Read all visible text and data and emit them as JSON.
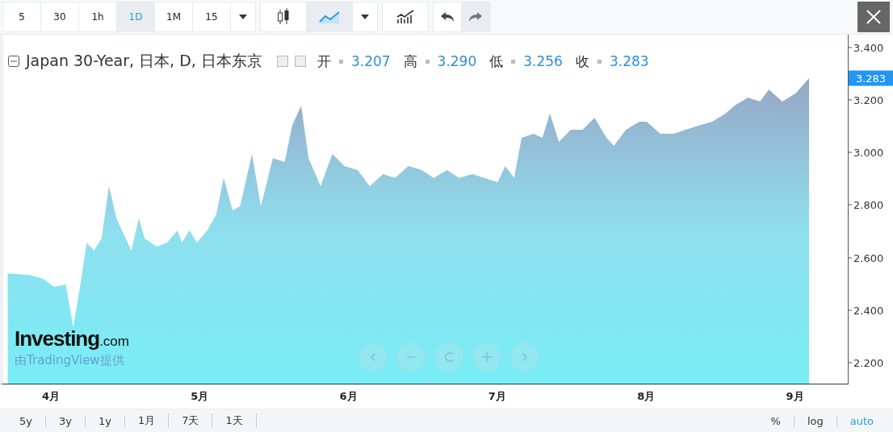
{
  "toolbar": {
    "intervals": [
      {
        "label": "5",
        "selected": false
      },
      {
        "label": "30",
        "selected": false
      },
      {
        "label": "1h",
        "selected": false
      },
      {
        "label": "1D",
        "selected": true
      },
      {
        "label": "1M",
        "selected": false
      },
      {
        "label": "15",
        "selected": false
      }
    ],
    "chart_types": [
      {
        "kind": "candles",
        "selected": false
      },
      {
        "kind": "area",
        "selected": true
      }
    ]
  },
  "legend": {
    "title": "Japan 30-Year, 日本, D, 日本东京",
    "ohlc": [
      {
        "label": "开",
        "value": "3.207"
      },
      {
        "label": "高",
        "value": "3.290"
      },
      {
        "label": "低",
        "value": "3.256"
      },
      {
        "label": "收",
        "value": "3.283"
      }
    ]
  },
  "last_price": "3.283",
  "logo": {
    "name": "Investing",
    "suffix": ".com",
    "credit": "由TradingView提供"
  },
  "chart": {
    "chart_data": {
      "type": "area",
      "x": [
        3.71,
        3.85,
        3.95,
        4.02,
        4.1,
        4.15,
        4.2,
        4.24,
        4.29,
        4.34,
        4.39,
        4.44,
        4.49,
        4.54,
        4.59,
        4.63,
        4.71,
        4.78,
        4.85,
        4.88,
        4.93,
        4.98,
        5.05,
        5.11,
        5.16,
        5.22,
        5.27,
        5.35,
        5.41,
        5.49,
        5.57,
        5.62,
        5.68,
        5.73,
        5.81,
        5.89,
        5.97,
        6.06,
        6.14,
        6.23,
        6.31,
        6.4,
        6.49,
        6.57,
        6.66,
        6.74,
        6.83,
        6.91,
        7.0,
        7.05,
        7.11,
        7.16,
        7.24,
        7.3,
        7.35,
        7.41,
        7.49,
        7.57,
        7.65,
        7.73,
        7.78,
        7.86,
        7.95,
        8.0,
        8.09,
        8.18,
        8.26,
        8.35,
        8.44,
        8.53,
        8.59,
        8.68,
        8.76,
        8.82,
        8.91,
        9.0,
        9.09
      ],
      "series": [
        {
          "color": "#8fdfee",
          "values": [
            2.538,
            2.532,
            2.517,
            2.486,
            2.495,
            2.332,
            2.502,
            2.655,
            2.625,
            2.671,
            2.871,
            2.748,
            2.686,
            2.625,
            2.748,
            2.671,
            2.64,
            2.655,
            2.702,
            2.655,
            2.702,
            2.655,
            2.702,
            2.763,
            2.902,
            2.778,
            2.794,
            2.994,
            2.794,
            2.978,
            2.963,
            3.102,
            3.178,
            2.978,
            2.871,
            2.994,
            2.948,
            2.932,
            2.871,
            2.917,
            2.902,
            2.948,
            2.932,
            2.902,
            2.932,
            2.902,
            2.917,
            2.902,
            2.886,
            2.948,
            2.902,
            3.055,
            3.071,
            3.055,
            3.148,
            3.04,
            3.086,
            3.086,
            3.132,
            3.055,
            3.025,
            3.086,
            3.117,
            3.117,
            3.071,
            3.071,
            3.086,
            3.102,
            3.117,
            3.148,
            3.178,
            3.209,
            3.194,
            3.24,
            3.194,
            3.225,
            3.283
          ]
        }
      ],
      "xlim": [
        3.68,
        9.35
      ],
      "ylim": [
        2.117,
        3.449
      ],
      "xticks": [
        {
          "value": 4,
          "label": "4月"
        },
        {
          "value": 5,
          "label": "5月"
        },
        {
          "value": 6,
          "label": "6月"
        },
        {
          "value": 7,
          "label": "7月"
        },
        {
          "value": 8,
          "label": "8月"
        },
        {
          "value": 9,
          "label": "9月"
        }
      ],
      "yticks": [
        {
          "value": 2.2,
          "label": "2.200"
        },
        {
          "value": 2.4,
          "label": "2.400"
        },
        {
          "value": 2.6,
          "label": "2.600"
        },
        {
          "value": 2.8,
          "label": "2.800"
        },
        {
          "value": 3.0,
          "label": "3.000"
        },
        {
          "value": 3.2,
          "label": "3.200"
        },
        {
          "value": 3.4,
          "label": "3.400"
        }
      ]
    }
  },
  "ranges": [
    {
      "label": "5y"
    },
    {
      "label": "3y"
    },
    {
      "label": "1y"
    },
    {
      "label": "1月"
    },
    {
      "label": "7天"
    },
    {
      "label": "1天"
    }
  ],
  "scale_options": [
    {
      "label": "%",
      "selected": false
    },
    {
      "label": "log",
      "selected": false
    },
    {
      "label": "auto",
      "selected": true
    }
  ]
}
